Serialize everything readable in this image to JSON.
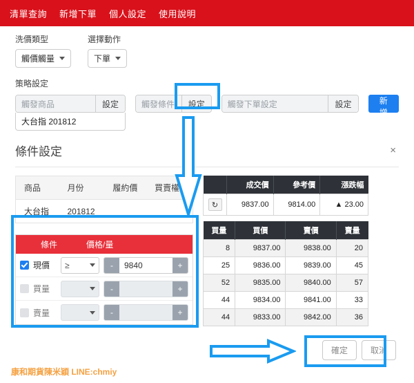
{
  "navbar": {
    "items": [
      {
        "label": "清單查詢"
      },
      {
        "label": "新增下單"
      },
      {
        "label": "個人設定"
      },
      {
        "label": "使用說明"
      }
    ],
    "background": "#d9111b"
  },
  "form": {
    "wash_type": {
      "label": "洗價類型",
      "value": "觸價觸量"
    },
    "action": {
      "label": "選擇動作",
      "value": "下單"
    }
  },
  "strategy": {
    "section_label": "策略設定",
    "trigger_product": {
      "placeholder": "觸發商品",
      "set_label": "設定",
      "value": "大台指 201812"
    },
    "trigger_condition": {
      "placeholder": "觸發條件",
      "set_label": "設定"
    },
    "trigger_order": {
      "placeholder": "觸發下單設定",
      "set_label": "設定"
    },
    "add_label": "新增"
  },
  "dialog": {
    "title": "條件設定",
    "close_icon": "×",
    "product_table": {
      "headers": [
        "商品",
        "月份",
        "履約價",
        "買賣權"
      ],
      "rows": [
        [
          "大台指",
          "201812",
          "",
          ""
        ]
      ]
    },
    "condition_table": {
      "headers": [
        "條件",
        "價格/量"
      ],
      "rows": [
        {
          "checked": true,
          "name": "現價",
          "operator": "≥",
          "value": "9840",
          "minus": "-",
          "plus": "+",
          "enabled": true
        },
        {
          "checked": false,
          "name": "買量",
          "operator": "",
          "value": "",
          "minus": "-",
          "plus": "+",
          "enabled": false
        },
        {
          "checked": false,
          "name": "賣量",
          "operator": "",
          "value": "",
          "minus": "-",
          "plus": "+",
          "enabled": false
        }
      ]
    },
    "quote": {
      "headers": [
        "",
        "成交價",
        "參考價",
        "漲跌幅"
      ],
      "refresh_icon": "↻",
      "last_price": "9837.00",
      "ref_price": "9814.00",
      "change": "▲ 23.00",
      "change_color": "#d0021b"
    },
    "order_book": {
      "headers": [
        "買量",
        "買價",
        "賣價",
        "賣量"
      ],
      "rows": [
        [
          "8",
          "9837.00",
          "9838.00",
          "20"
        ],
        [
          "25",
          "9836.00",
          "9839.00",
          "45"
        ],
        [
          "52",
          "9835.00",
          "9840.00",
          "57"
        ],
        [
          "44",
          "9834.00",
          "9841.00",
          "33"
        ],
        [
          "44",
          "9833.00",
          "9842.00",
          "36"
        ]
      ]
    },
    "confirm_label": "確定",
    "cancel_label": "取消"
  },
  "annotations": {
    "highlight_color": "#1a9bf0",
    "watermark": "康和期貨陳米穎 LINE:chmiy"
  }
}
